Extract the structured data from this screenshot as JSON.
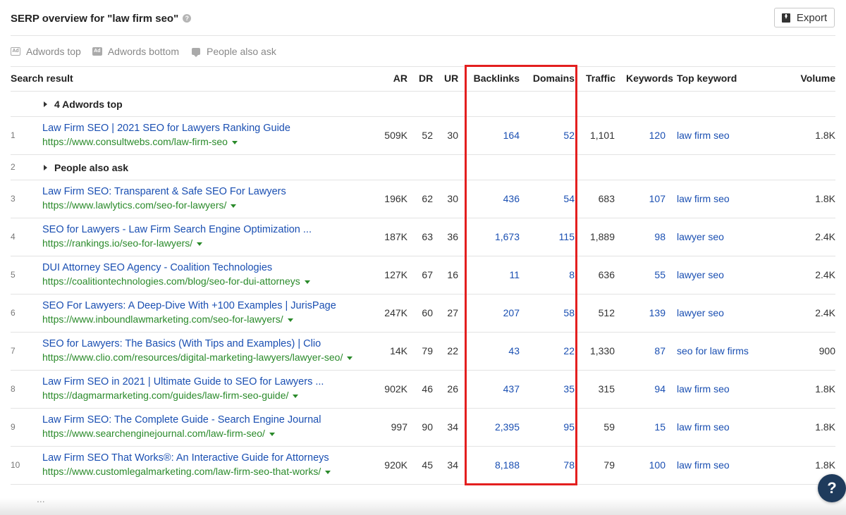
{
  "header": {
    "title": "SERP overview for \"law firm seo\"",
    "help": "?",
    "export_label": "Export"
  },
  "filters": [
    {
      "label": "Adwords top",
      "icon": "adwords-top-icon",
      "icon_text": "Ad"
    },
    {
      "label": "Adwords bottom",
      "icon": "adwords-bottom-icon",
      "icon_text": "Ad"
    },
    {
      "label": "People also ask",
      "icon": "comment-bubble-icon"
    }
  ],
  "columns": {
    "search_result": "Search result",
    "ar": "AR",
    "dr": "DR",
    "ur": "UR",
    "backlinks": "Backlinks",
    "domains": "Domains",
    "traffic": "Traffic",
    "keywords": "Keywords",
    "top_keyword": "Top keyword",
    "volume": "Volume"
  },
  "group_adwords": {
    "label": "4 Adwords top"
  },
  "group_paa": {
    "pos": "2",
    "label": "People also ask"
  },
  "rows": [
    {
      "pos": "1",
      "title": "Law Firm SEO | 2021 SEO for Lawyers Ranking Guide",
      "url": "https://www.consultwebs.com/law-firm-seo",
      "ar": "509K",
      "dr": "52",
      "ur": "30",
      "backlinks": "164",
      "domains": "52",
      "traffic": "1,101",
      "keywords": "120",
      "top_keyword": "law firm seo",
      "volume": "1.8K"
    },
    {
      "pos": "3",
      "title": "Law Firm SEO: Transparent & Safe SEO For Lawyers",
      "url": "https://www.lawlytics.com/seo-for-lawyers/",
      "ar": "196K",
      "dr": "62",
      "ur": "30",
      "backlinks": "436",
      "domains": "54",
      "traffic": "683",
      "keywords": "107",
      "top_keyword": "law firm seo",
      "volume": "1.8K"
    },
    {
      "pos": "4",
      "title": "SEO for Lawyers - Law Firm Search Engine Optimization ...",
      "url": "https://rankings.io/seo-for-lawyers/",
      "ar": "187K",
      "dr": "63",
      "ur": "36",
      "backlinks": "1,673",
      "domains": "115",
      "traffic": "1,889",
      "keywords": "98",
      "top_keyword": "lawyer seo",
      "volume": "2.4K"
    },
    {
      "pos": "5",
      "title": "DUI Attorney SEO Agency - Coalition Technologies",
      "url": "https://coalitiontechnologies.com/blog/seo-for-dui-attorneys",
      "ar": "127K",
      "dr": "67",
      "ur": "16",
      "backlinks": "11",
      "domains": "8",
      "traffic": "636",
      "keywords": "55",
      "top_keyword": "lawyer seo",
      "volume": "2.4K"
    },
    {
      "pos": "6",
      "title": "SEO For Lawyers: A Deep-Dive With +100 Examples | JurisPage",
      "url": "https://www.inboundlawmarketing.com/seo-for-lawyers/",
      "ar": "247K",
      "dr": "60",
      "ur": "27",
      "backlinks": "207",
      "domains": "58",
      "traffic": "512",
      "keywords": "139",
      "top_keyword": "lawyer seo",
      "volume": "2.4K"
    },
    {
      "pos": "7",
      "title": "SEO for Lawyers: The Basics (With Tips and Examples) | Clio",
      "url": "https://www.clio.com/resources/digital-marketing-lawyers/lawyer-seo/",
      "ar": "14K",
      "dr": "79",
      "ur": "22",
      "backlinks": "43",
      "domains": "22",
      "traffic": "1,330",
      "keywords": "87",
      "top_keyword": "seo for law firms",
      "volume": "900"
    },
    {
      "pos": "8",
      "title": "Law Firm SEO in 2021 | Ultimate Guide to SEO for Lawyers ...",
      "url": "https://dagmarmarketing.com/guides/law-firm-seo-guide/",
      "ar": "902K",
      "dr": "46",
      "ur": "26",
      "backlinks": "437",
      "domains": "35",
      "traffic": "315",
      "keywords": "94",
      "top_keyword": "law firm seo",
      "volume": "1.8K"
    },
    {
      "pos": "9",
      "title": "Law Firm SEO: The Complete Guide - Search Engine Journal",
      "url": "https://www.searchenginejournal.com/law-firm-seo/",
      "ar": "997",
      "dr": "90",
      "ur": "34",
      "backlinks": "2,395",
      "domains": "95",
      "traffic": "59",
      "keywords": "15",
      "top_keyword": "law firm seo",
      "volume": "1.8K"
    },
    {
      "pos": "10",
      "title": "Law Firm SEO That Works®: An Interactive Guide for Attorneys",
      "url": "https://www.customlegalmarketing.com/law-firm-seo-that-works/",
      "ar": "920K",
      "dr": "45",
      "ur": "34",
      "backlinks": "8,188",
      "domains": "78",
      "traffic": "79",
      "keywords": "100",
      "top_keyword": "law firm seo",
      "volume": "1.8K"
    }
  ],
  "more": "...",
  "help_fab": "?",
  "colors": {
    "link_blue": "#1a4fb2",
    "url_green": "#2a8a2a",
    "highlight_red": "#e31f1f",
    "fab_navy": "#1f3b5c"
  }
}
